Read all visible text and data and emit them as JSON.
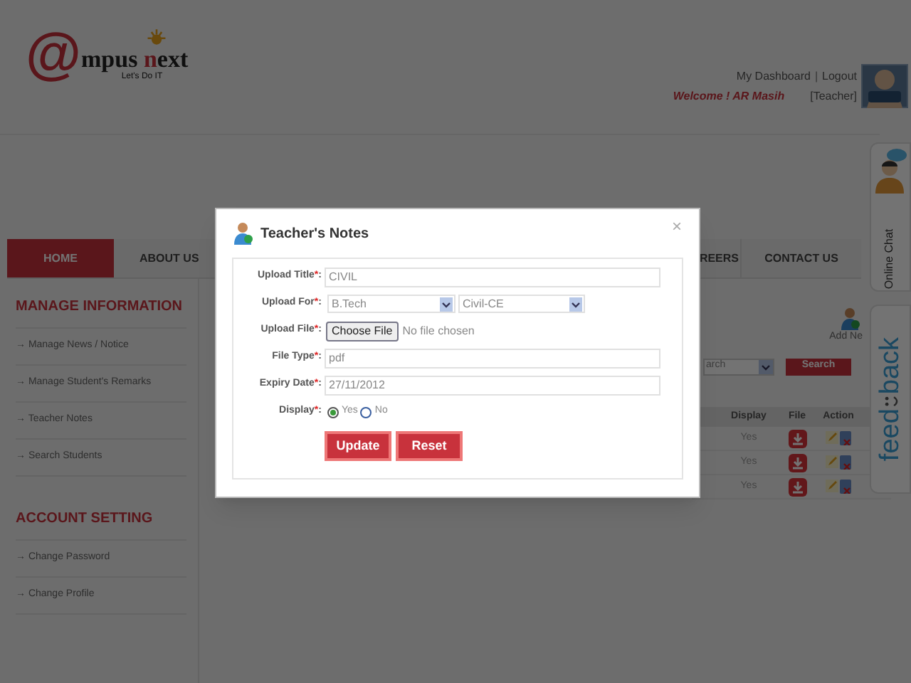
{
  "logo": {
    "at": "@",
    "part1": "mpus ",
    "accent": "n",
    "part2": "ext",
    "tagline": "Let's Do IT"
  },
  "user_links": [
    {
      "kind": "link",
      "text": "My Dashboard"
    },
    {
      "kind": "sep",
      "text": "|"
    },
    {
      "kind": "link",
      "text": "Logout"
    }
  ],
  "welcome": "Welcome ! AR Masih",
  "role": "[Teacher]",
  "nav": [
    {
      "label": "HOME",
      "selected": true
    },
    {
      "label": "ABOUT US",
      "selected": false
    },
    {
      "label": "REERS",
      "selected": false
    },
    {
      "label": "CONTACT US",
      "selected": false
    }
  ],
  "sidebar": [
    {
      "heading": "MANAGE INFORMATION",
      "items": [
        "→ Manage News / Notice",
        "→ Manage Student's Remarks",
        "→ Teacher Notes",
        "→ Search Students"
      ]
    },
    {
      "heading": "ACCOUNT SETTING",
      "items": [
        "→ Change Password",
        "→ Change Profile"
      ]
    }
  ],
  "content": {
    "add_label": "Add Ne",
    "search_select": "arch",
    "search_button": "Search",
    "columns": [
      "Display",
      "File",
      "Action"
    ],
    "rows": [
      {
        "display": "Yes"
      },
      {
        "display": "Yes"
      },
      {
        "display": "Yes"
      }
    ]
  },
  "side_tabs": {
    "chat": "Online Chat",
    "feedback": [
      "feed",
      "back"
    ]
  },
  "dialog": {
    "title": "Teacher's Notes",
    "close": "×",
    "fields": [
      {
        "kind": "text",
        "label": "Upload Title",
        "mark": "*",
        "colon": ":",
        "value": "CIVIL"
      },
      {
        "kind": "selects",
        "label": "Upload For",
        "mark": "*",
        "colon": ":",
        "options": [
          "B.Tech",
          "Civil-CE"
        ]
      },
      {
        "kind": "file",
        "label": "Upload File",
        "mark": "*",
        "colon": ":",
        "button": "Choose File",
        "status": "No file chosen"
      },
      {
        "kind": "text",
        "label": "File Type",
        "mark": "*",
        "colon": ":",
        "value": "pdf"
      },
      {
        "kind": "text",
        "label": "Expiry Date",
        "mark": "*",
        "colon": ":",
        "value": "27/11/2012"
      },
      {
        "kind": "radio",
        "label": "Display",
        "mark": "*",
        "colon": ":",
        "choices": [
          {
            "label": "Yes",
            "selected": true
          },
          {
            "label": "No",
            "selected": false
          }
        ]
      }
    ],
    "buttons": [
      "Update",
      "Reset"
    ]
  }
}
